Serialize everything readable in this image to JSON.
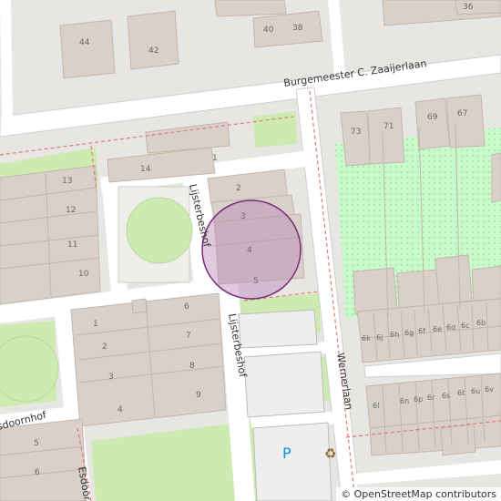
{
  "map": {
    "streets": {
      "burgemeester": "Burgemeester C. Zaaijerlaan",
      "lijsterbeshof_north": "Lijsterbeshof",
      "lijsterbeshof_south": "Lijsterbeshof",
      "wernerlaan": "Wernerlaan",
      "esdoornhof": "sdoornhof",
      "esdoorn": "Esdoorn"
    },
    "house_numbers": {
      "n44": "44",
      "n42": "42",
      "n40": "40",
      "n38": "38",
      "n36": "36",
      "n73": "73",
      "n71": "71",
      "n69": "69",
      "n67": "67",
      "n14": "14",
      "n1": "1",
      "n13": "13",
      "n12": "12",
      "n11": "11",
      "n10": "10",
      "n2": "2",
      "n3": "3",
      "n4": "4",
      "n5": "5",
      "w6": "6",
      "w7": "7",
      "w8": "8",
      "w9": "9",
      "w1": "1",
      "w2": "2",
      "w3": "3",
      "w4": "4",
      "s5": "5",
      "s6": "6",
      "r6k": "6k",
      "r6j": "6j",
      "r6h": "6h",
      "r6g": "6g",
      "r6f": "6f",
      "r6e": "6e",
      "r6d": "6d",
      "r6c": "6c",
      "r6b": "6b",
      "q6l": "6l",
      "q6n": "6n",
      "q6p": "6p",
      "q6r": "6r",
      "q6s": "6s",
      "q6t": "6t",
      "q6u": "6u",
      "q6v": "6v"
    },
    "parking_symbol": "P",
    "recycling_symbol": "♻",
    "colors": {
      "background": "#e8e6e3",
      "building": "#d9d0c9",
      "building_edge": "#c4b6ab",
      "road": "#ffffff",
      "grass": "#cdebb0",
      "allotment": "#c8facc",
      "marker_fill": "#b788b8",
      "marker_stroke": "#7a2a7a",
      "parking_text": "#0092da",
      "boundary": "#e07a7a"
    }
  },
  "attribution": "© OpenStreetMap contributors"
}
